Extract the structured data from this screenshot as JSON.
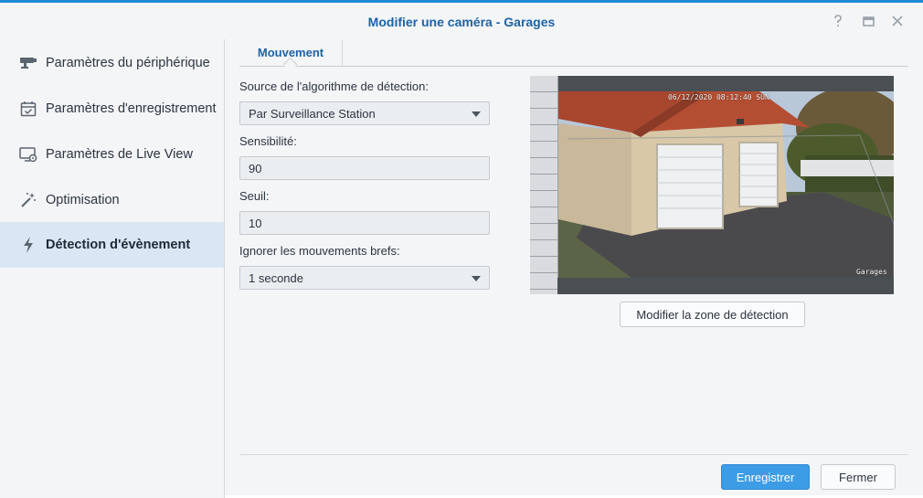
{
  "window": {
    "title": "Modifier une caméra - Garages",
    "controls": [
      "help-icon",
      "maximize-icon",
      "close-icon"
    ],
    "accent": "#1f8ad6"
  },
  "sidebar": {
    "items": [
      {
        "label": "Paramètres du périphérique",
        "icon": "camera-icon"
      },
      {
        "label": "Paramètres d'enregistrement",
        "icon": "calendar-check-icon"
      },
      {
        "label": "Paramètres de Live View",
        "icon": "monitor-icon"
      },
      {
        "label": "Optimisation",
        "icon": "magic-wand-icon"
      },
      {
        "label": "Détection d'évènement",
        "icon": "lightning-icon",
        "active": true
      }
    ],
    "active_color": "#d8e7f3"
  },
  "tabs": [
    {
      "label": "Mouvement",
      "active": true
    }
  ],
  "form": {
    "source": {
      "label": "Source de l'algorithme de détection:",
      "value": "Par Surveillance Station"
    },
    "sensitivity": {
      "label": "Sensibilité:",
      "value": "90"
    },
    "threshold": {
      "label": "Seuil:",
      "value": "10"
    },
    "ignore": {
      "label": "Ignorer les mouvements brefs:",
      "value": "1 seconde"
    }
  },
  "preview": {
    "timestamp": "06/12/2020 08:12:40 SUN",
    "camera_name": "Garages"
  },
  "buttons": {
    "edit_zone": "Modifier la zone de détection",
    "save": "Enregistrer",
    "close": "Fermer",
    "primary_color": "#3d9ce6"
  }
}
